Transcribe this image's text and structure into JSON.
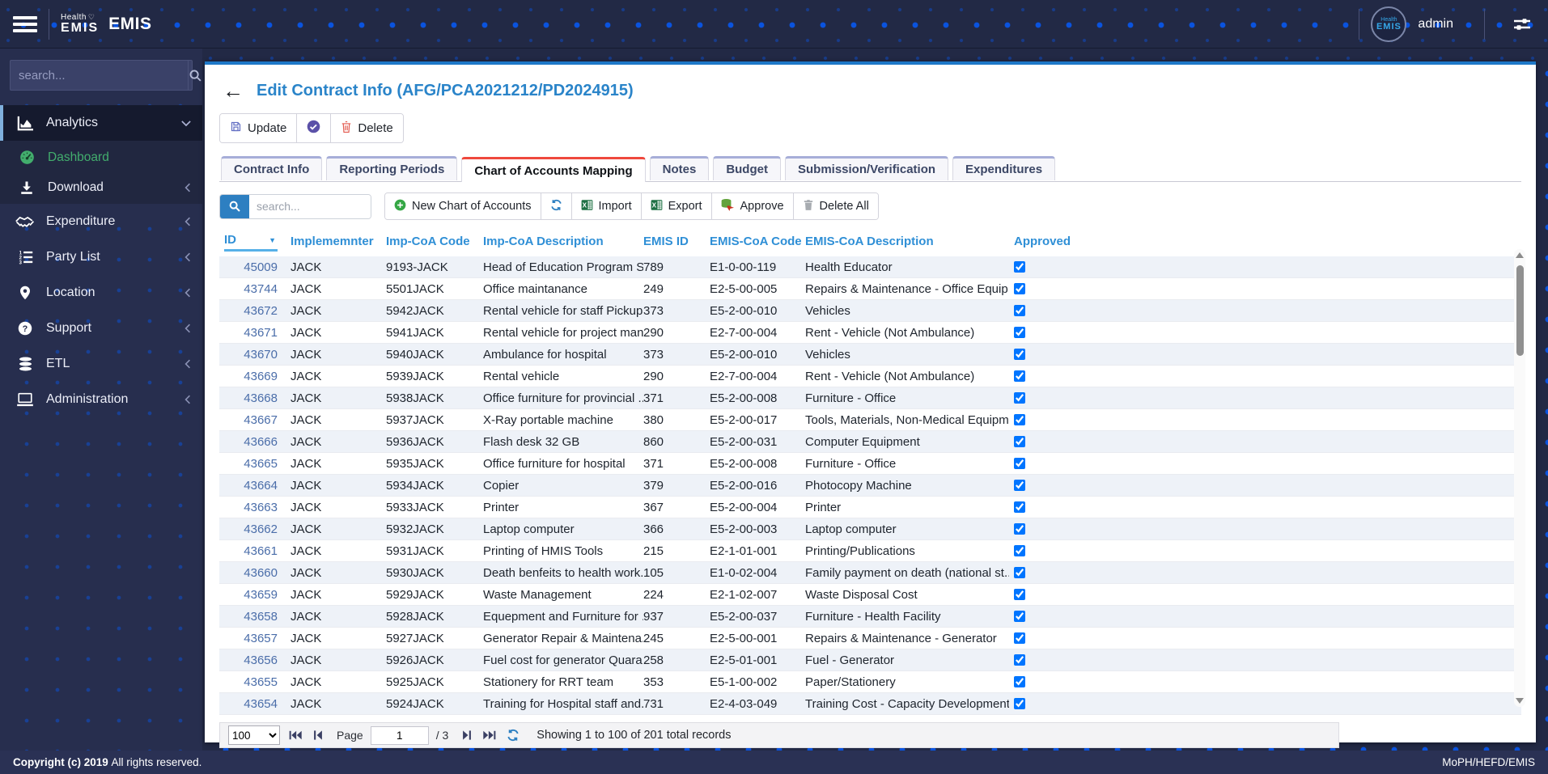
{
  "topbar": {
    "logo_small_top": "Health",
    "logo_small_bottom": "EMIS",
    "brand": "EMIS",
    "user": "admin"
  },
  "sidebar": {
    "search_placeholder": "search...",
    "items": [
      {
        "label": "Analytics",
        "icon": "analytics-icon",
        "active": true,
        "expanded": true,
        "children": [
          {
            "label": "Dashboard",
            "icon": "dashboard-icon",
            "selected": true
          },
          {
            "label": "Download",
            "icon": "download-icon",
            "collapsible": true
          }
        ]
      },
      {
        "label": "Expenditure",
        "icon": "expenditure-icon",
        "collapsible": true
      },
      {
        "label": "Party List",
        "icon": "party-list-icon",
        "collapsible": true
      },
      {
        "label": "Location",
        "icon": "location-icon",
        "collapsible": true
      },
      {
        "label": "Support",
        "icon": "support-icon",
        "collapsible": true
      },
      {
        "label": "ETL",
        "icon": "etl-icon",
        "collapsible": true
      },
      {
        "label": "Administration",
        "icon": "administration-icon",
        "collapsible": true
      }
    ]
  },
  "page": {
    "title": "Edit Contract Info (AFG/PCA2021212/PD2024915)",
    "actions": {
      "update": "Update",
      "delete": "Delete"
    }
  },
  "tabs": [
    {
      "label": "Contract Info",
      "active": false
    },
    {
      "label": "Reporting Periods",
      "active": false
    },
    {
      "label": "Chart of Accounts Mapping",
      "active": true
    },
    {
      "label": "Notes",
      "active": false
    },
    {
      "label": "Budget",
      "active": false
    },
    {
      "label": "Submission/Verification",
      "active": false
    },
    {
      "label": "Expenditures",
      "active": false
    }
  ],
  "grid_toolbar": {
    "search_placeholder": "search...",
    "new_label": "New Chart of Accounts",
    "import_label": "Import",
    "export_label": "Export",
    "approve_label": "Approve",
    "delete_all_label": "Delete All"
  },
  "table": {
    "columns": [
      "ID",
      "Implememnter",
      "Imp-CoA Code",
      "Imp-CoA Description",
      "EMIS ID",
      "EMIS-CoA Code",
      "EMIS-CoA Description",
      "Approved"
    ],
    "sorted_column": "ID",
    "rows": [
      {
        "id": "45009",
        "implementer": "JACK",
        "imp_code": "9193-JACK",
        "imp_desc": "Head of Education Program S...",
        "emis_id": "789",
        "emis_code": "E1-0-00-119",
        "emis_desc": "Health Educator",
        "approved": true
      },
      {
        "id": "43744",
        "implementer": "JACK",
        "imp_code": "5501JACK",
        "imp_desc": "Office maintanance",
        "emis_id": "249",
        "emis_code": "E2-5-00-005",
        "emis_desc": "Repairs & Maintenance - Office Equip...",
        "approved": true
      },
      {
        "id": "43672",
        "implementer": "JACK",
        "imp_code": "5942JACK",
        "imp_desc": "Rental vehicle for staff Pickup...",
        "emis_id": "373",
        "emis_code": "E5-2-00-010",
        "emis_desc": "Vehicles",
        "approved": true
      },
      {
        "id": "43671",
        "implementer": "JACK",
        "imp_code": "5941JACK",
        "imp_desc": "Rental vehicle for project man...",
        "emis_id": "290",
        "emis_code": "E2-7-00-004",
        "emis_desc": "Rent - Vehicle (Not Ambulance)",
        "approved": true
      },
      {
        "id": "43670",
        "implementer": "JACK",
        "imp_code": "5940JACK",
        "imp_desc": "Ambulance for hospital",
        "emis_id": "373",
        "emis_code": "E5-2-00-010",
        "emis_desc": "Vehicles",
        "approved": true
      },
      {
        "id": "43669",
        "implementer": "JACK",
        "imp_code": "5939JACK",
        "imp_desc": "Rental vehicle",
        "emis_id": "290",
        "emis_code": "E2-7-00-004",
        "emis_desc": "Rent - Vehicle (Not Ambulance)",
        "approved": true
      },
      {
        "id": "43668",
        "implementer": "JACK",
        "imp_code": "5938JACK",
        "imp_desc": "Office furniture for provincial ...",
        "emis_id": "371",
        "emis_code": "E5-2-00-008",
        "emis_desc": "Furniture - Office",
        "approved": true
      },
      {
        "id": "43667",
        "implementer": "JACK",
        "imp_code": "5937JACK",
        "imp_desc": "X-Ray portable machine",
        "emis_id": "380",
        "emis_code": "E5-2-00-017",
        "emis_desc": "Tools, Materials, Non-Medical Equipm...",
        "approved": true
      },
      {
        "id": "43666",
        "implementer": "JACK",
        "imp_code": "5936JACK",
        "imp_desc": "Flash desk 32 GB",
        "emis_id": "860",
        "emis_code": "E5-2-00-031",
        "emis_desc": "Computer Equipment",
        "approved": true
      },
      {
        "id": "43665",
        "implementer": "JACK",
        "imp_code": "5935JACK",
        "imp_desc": "Office furniture for hospital",
        "emis_id": "371",
        "emis_code": "E5-2-00-008",
        "emis_desc": "Furniture - Office",
        "approved": true
      },
      {
        "id": "43664",
        "implementer": "JACK",
        "imp_code": "5934JACK",
        "imp_desc": "Copier",
        "emis_id": "379",
        "emis_code": "E5-2-00-016",
        "emis_desc": "Photocopy Machine",
        "approved": true
      },
      {
        "id": "43663",
        "implementer": "JACK",
        "imp_code": "5933JACK",
        "imp_desc": "Printer",
        "emis_id": "367",
        "emis_code": "E5-2-00-004",
        "emis_desc": "Printer",
        "approved": true
      },
      {
        "id": "43662",
        "implementer": "JACK",
        "imp_code": "5932JACK",
        "imp_desc": "Laptop computer",
        "emis_id": "366",
        "emis_code": "E5-2-00-003",
        "emis_desc": "Laptop computer",
        "approved": true
      },
      {
        "id": "43661",
        "implementer": "JACK",
        "imp_code": "5931JACK",
        "imp_desc": "Printing of HMIS Tools",
        "emis_id": "215",
        "emis_code": "E2-1-01-001",
        "emis_desc": "Printing/Publications",
        "approved": true
      },
      {
        "id": "43660",
        "implementer": "JACK",
        "imp_code": "5930JACK",
        "imp_desc": "Death benfeits to health work...",
        "emis_id": "105",
        "emis_code": "E1-0-02-004",
        "emis_desc": "Family payment on death (national st...",
        "approved": true
      },
      {
        "id": "43659",
        "implementer": "JACK",
        "imp_code": "5929JACK",
        "imp_desc": "Waste Management",
        "emis_id": "224",
        "emis_code": "E2-1-02-007",
        "emis_desc": "Waste Disposal Cost",
        "approved": true
      },
      {
        "id": "43658",
        "implementer": "JACK",
        "imp_code": "5928JACK",
        "imp_desc": "Equepment and Furniture for ...",
        "emis_id": "937",
        "emis_code": "E5-2-00-037",
        "emis_desc": "Furniture - Health Facility",
        "approved": true
      },
      {
        "id": "43657",
        "implementer": "JACK",
        "imp_code": "5927JACK",
        "imp_desc": "Generator Repair & Maintena...",
        "emis_id": "245",
        "emis_code": "E2-5-00-001",
        "emis_desc": "Repairs & Maintenance - Generator",
        "approved": true
      },
      {
        "id": "43656",
        "implementer": "JACK",
        "imp_code": "5926JACK",
        "imp_desc": "Fuel cost for generator Quara...",
        "emis_id": "258",
        "emis_code": "E2-5-01-001",
        "emis_desc": "Fuel - Generator",
        "approved": true
      },
      {
        "id": "43655",
        "implementer": "JACK",
        "imp_code": "5925JACK",
        "imp_desc": "Stationery for RRT team",
        "emis_id": "353",
        "emis_code": "E5-1-00-002",
        "emis_desc": "Paper/Stationery",
        "approved": true
      },
      {
        "id": "43654",
        "implementer": "JACK",
        "imp_code": "5924JACK",
        "imp_desc": "Training for Hospital staff and...",
        "emis_id": "731",
        "emis_code": "E2-4-03-049",
        "emis_desc": "Training Cost - Capacity Development",
        "approved": true
      }
    ]
  },
  "pagination": {
    "page_size": "100",
    "page_label": "Page",
    "current_page": "1",
    "total_pages_label": "/ 3",
    "status": "Showing 1 to 100 of 201 total records"
  },
  "footer": {
    "copyright_bold": "Copyright (c) 2019",
    "copyright_rest": "All rights reserved.",
    "right": "MoPH/HEFD/EMIS"
  },
  "colors": {
    "accent_blue": "#1e78c8",
    "link_blue": "#4a6da9",
    "header_blue": "#2f8fd6",
    "tab_active_red": "#ef483d",
    "dashboard_green": "#42ad6d"
  }
}
